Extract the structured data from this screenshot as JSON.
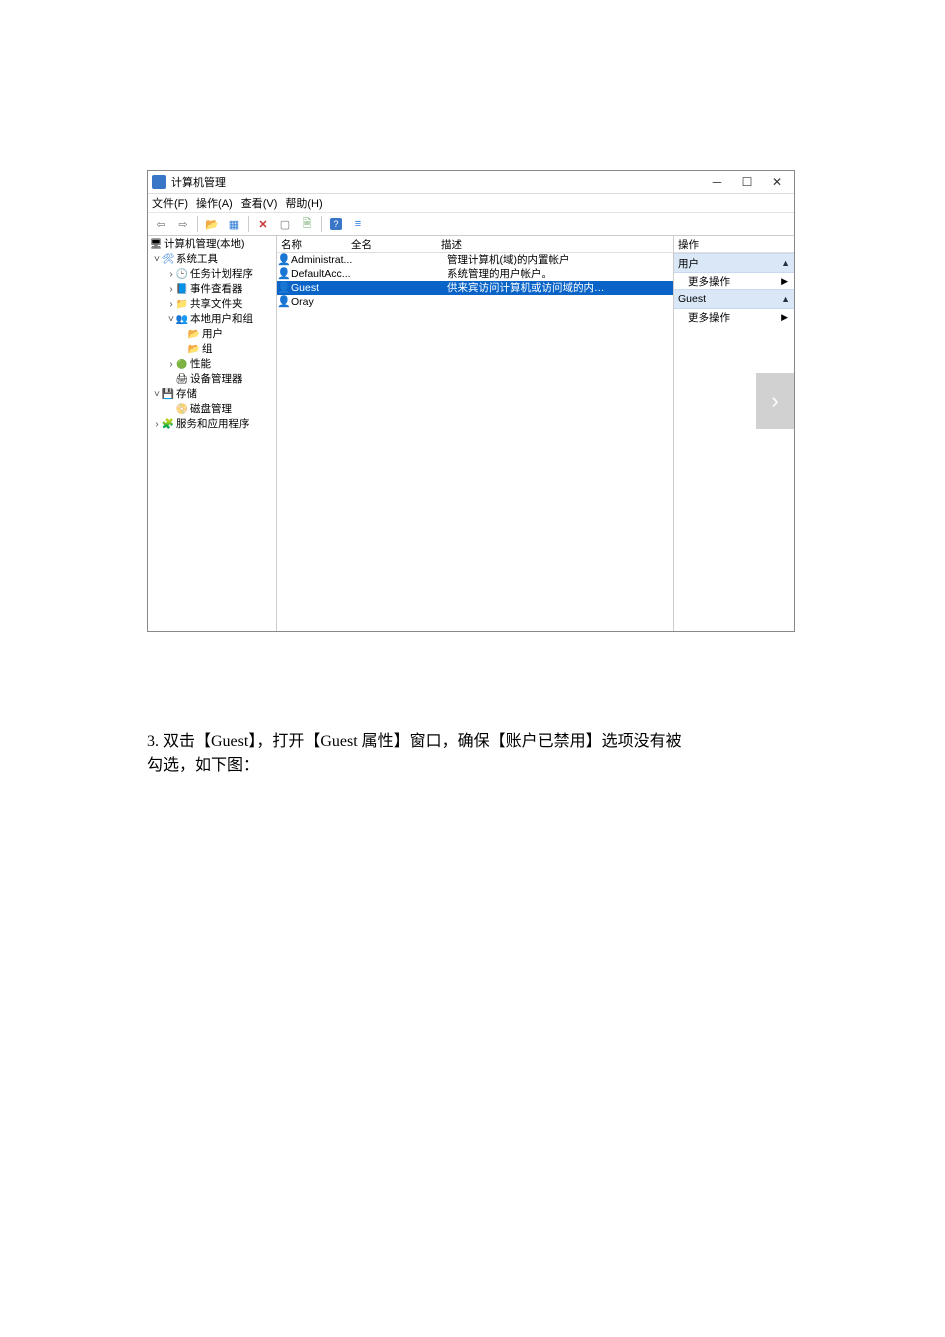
{
  "window": {
    "title": "计算机管理",
    "minimize": "─",
    "maximize": "☐",
    "close": "✕"
  },
  "menu": {
    "file": "文件(F)",
    "action": "操作(A)",
    "view": "查看(V)",
    "help": "帮助(H)"
  },
  "tree": {
    "root": "计算机管理(本地)",
    "system_tools": "系统工具",
    "task_scheduler": "任务计划程序",
    "event_viewer": "事件查看器",
    "shared_folders": "共享文件夹",
    "local_users": "本地用户和组",
    "users": "用户",
    "groups": "组",
    "performance": "性能",
    "device_mgr": "设备管理器",
    "storage": "存储",
    "disk_mgmt": "磁盘管理",
    "services_apps": "服务和应用程序"
  },
  "list": {
    "columns": {
      "name": "名称",
      "fullname": "全名",
      "description": "描述"
    },
    "rows": [
      {
        "name": "Administrat...",
        "fullname": "",
        "description": "管理计算机(域)的内置帐户"
      },
      {
        "name": "DefaultAcc...",
        "fullname": "",
        "description": "系统管理的用户帐户。"
      },
      {
        "name": "Guest",
        "fullname": "",
        "description": "供来宾访问计算机或访问域的内…",
        "selected": true
      },
      {
        "name": "Oray",
        "fullname": "",
        "description": ""
      }
    ]
  },
  "actions": {
    "header": "操作",
    "section1": "用户",
    "more1": "更多操作",
    "section2": "Guest",
    "more2": "更多操作"
  },
  "overlay": {
    "next": "›"
  },
  "instruction": {
    "line1": "3. 双击【Guest】，打开【Guest 属性】窗口，确保【账户已禁用】选项没有被",
    "line2": "勾选，如下图："
  }
}
